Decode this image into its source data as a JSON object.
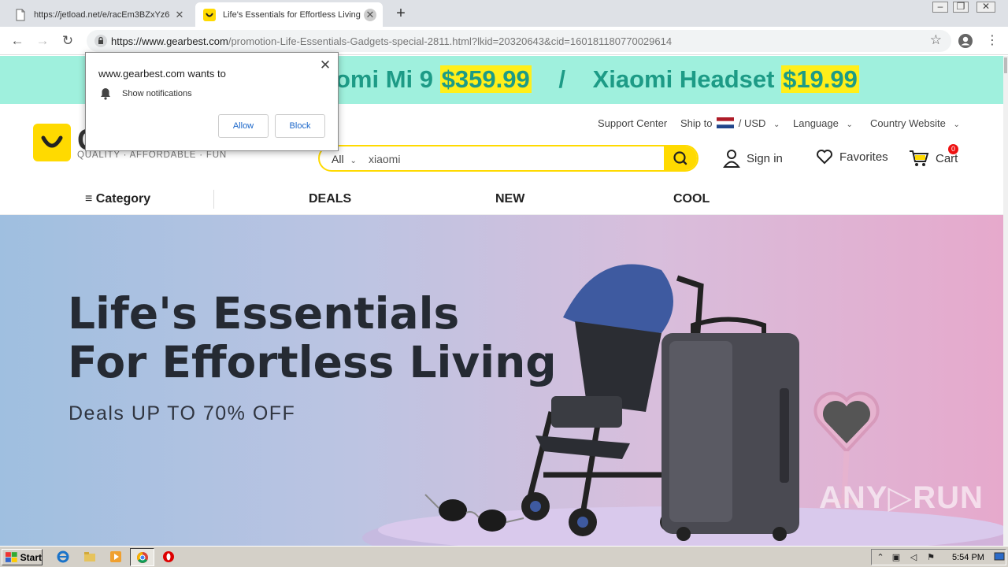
{
  "browser": {
    "tabs": [
      {
        "title": "https://jetload.net/e/racEm3BZxYz6",
        "active": false
      },
      {
        "title": "Life's Essentials for Effortless Living",
        "active": true
      }
    ],
    "new_tab_label": "+",
    "url_host": "https://www.gearbest.com",
    "url_path": "/promotion-Life-Essentials-Gadgets-special-2811.html?lkid=20320643&cid=160181180770029614"
  },
  "notification_popup": {
    "heading": "www.gearbest.com wants to",
    "permission": "Show notifications",
    "allow_label": "Allow",
    "block_label": "Block"
  },
  "promo_banner": {
    "item1_name": "omi Mi 9",
    "item1_price": "$359.99",
    "separator": "/",
    "item2_name": "Xiaomi Headset",
    "item2_price": "$19.99"
  },
  "header": {
    "logo_letter": "G",
    "tagline": "QUALITY · AFFORDABLE · FUN",
    "support_center": "Support Center",
    "ship_to_label": "Ship to",
    "currency": "/ USD",
    "language": "Language",
    "country_website": "Country Website",
    "search_category": "All",
    "search_value": "xiaomi",
    "sign_in": "Sign in",
    "favorites": "Favorites",
    "cart": "Cart",
    "cart_count": "0"
  },
  "category_nav": {
    "category": "Category",
    "items": [
      "DEALS",
      "NEW",
      "COOL"
    ]
  },
  "hero": {
    "title_line1": "Life's Essentials",
    "title_line2": "For Effortless Living",
    "subtitle": "Deals UP TO 70% OFF",
    "watermark": "ANY▷RUN"
  },
  "taskbar": {
    "start_label": "Start",
    "clock": "5:54 PM"
  },
  "colors": {
    "brand_yellow": "#ffda00",
    "promo_bg": "#9ff0dd",
    "promo_text": "#1d9b86",
    "price_highlight": "#ffef1a"
  }
}
